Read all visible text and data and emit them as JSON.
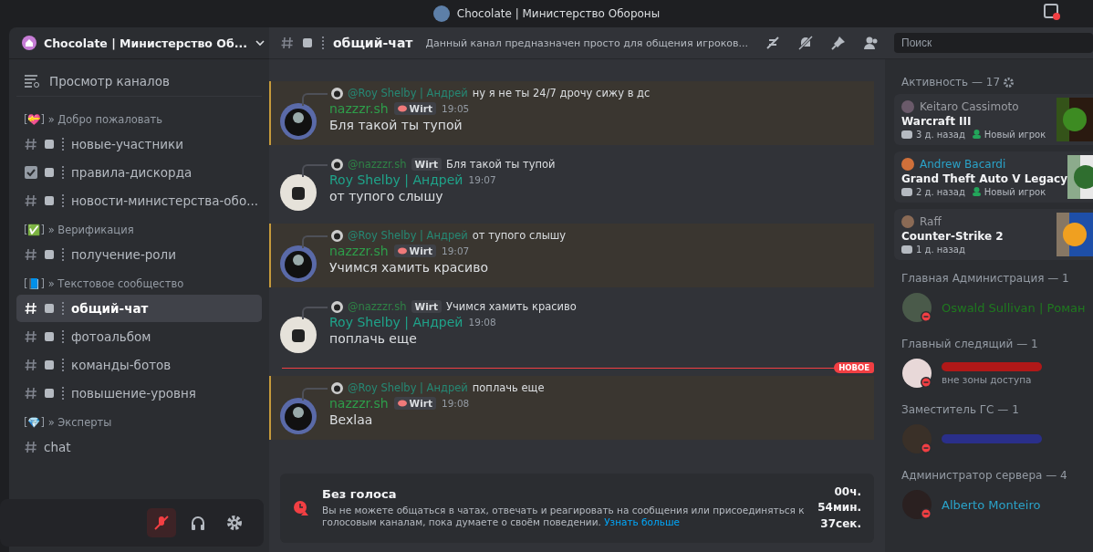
{
  "title_bar": {
    "title": "Chocolate | Министерство Обороны"
  },
  "server": {
    "name": "Chocolate | Министерство Об..."
  },
  "sidebar": {
    "browse_label": "Просмотр каналов",
    "categories": [
      {
        "name": "[💝] » Добро пожаловать",
        "channels": [
          {
            "kind": "hash",
            "label": "новые-участники",
            "selected": false
          },
          {
            "kind": "rules",
            "label": "правила-дискорда",
            "selected": false
          },
          {
            "kind": "hash",
            "label": "новости-министерства-обо...",
            "selected": false
          }
        ]
      },
      {
        "name": "[✅] » Верификация",
        "channels": [
          {
            "kind": "hash",
            "label": "получение-роли",
            "selected": false
          }
        ]
      },
      {
        "name": "[📘] » Текстовое сообщество",
        "channels": [
          {
            "kind": "hash",
            "label": "общий-чат",
            "selected": true
          },
          {
            "kind": "hash",
            "label": "фотоальбом",
            "selected": false
          },
          {
            "kind": "hash",
            "label": "команды-ботов",
            "selected": false
          },
          {
            "kind": "hash",
            "label": "повышение-уровня",
            "selected": false
          }
        ]
      },
      {
        "name": "[💎] » Эксперты",
        "channels": [
          {
            "kind": "thread",
            "label": "chat",
            "selected": false
          }
        ]
      }
    ]
  },
  "user_panel": {
    "mic_muted": true
  },
  "channel_header": {
    "name": "общий-чат",
    "topic": "Данный канал предназначен просто для общения игроков..."
  },
  "messages": [
    {
      "kind": "message",
      "mentioned": true,
      "reply_author": "@Roy Shelby | Андрей",
      "reply_badge": false,
      "reply_text": "ну я не ты 24/7 дрочу сижу в дс",
      "author": "nazzzr.sh",
      "color": "#2e9d4a",
      "badge": "Wirt",
      "time": "19:05",
      "text": "Бля такой ты тупой"
    },
    {
      "kind": "message",
      "mentioned": false,
      "reply_author": "@nazzzr.sh",
      "reply_badge": "Wirt",
      "reply_text": "Бля такой ты тупой",
      "author": "Roy Shelby | Андрей",
      "color": "#1fa38a",
      "time": "19:07",
      "text": "от тупого слышу"
    },
    {
      "kind": "message",
      "mentioned": true,
      "reply_author": "@Roy Shelby | Андрей",
      "reply_badge": false,
      "reply_text": "от тупого слышу",
      "author": "nazzzr.sh",
      "color": "#2e9d4a",
      "badge": "Wirt",
      "time": "19:07",
      "text": "Учимся хамить красиво"
    },
    {
      "kind": "message",
      "mentioned": false,
      "reply_author": "@nazzzr.sh",
      "reply_badge": "Wirt",
      "reply_text": "Учимся хамить красиво",
      "author": "Roy Shelby | Андрей",
      "color": "#1fa38a",
      "time": "19:08",
      "text": "поплачь еще"
    },
    {
      "kind": "divider",
      "label": "НОВОЕ"
    },
    {
      "kind": "message",
      "mentioned": true,
      "reply_author": "@Roy Shelby | Андрей",
      "reply_badge": false,
      "reply_text": "поплачь еще",
      "author": "nazzzr.sh",
      "color": "#2e9d4a",
      "badge": "Wirt",
      "time": "19:08",
      "text": "Bexlaa"
    }
  ],
  "notice": {
    "title": "Без голоса",
    "text": "Вы не можете общаться в чатах, отвечать и реагировать на сообщения или присоединяться к голосовым каналам, пока думаете о своём поведении.",
    "link": "Узнать больше",
    "timer": [
      "00ч.",
      "54мин.",
      "37сек."
    ]
  },
  "members": {
    "search": {
      "placeholder": "Поиск"
    },
    "activity_title": "Активность — 17",
    "activity": [
      {
        "name": "Keitaro Cassimoto",
        "color": "#9a9ca2",
        "game": "Warcraft III",
        "ago": "3 д. назад",
        "new_player": "Новый игрок"
      },
      {
        "name": "Andrew Bacardi",
        "color": "#2aa3c9",
        "game": "Grand Theft Auto V Legacy",
        "ago": "2 д. назад",
        "new_player": "Новый игрок"
      },
      {
        "name": "Raff",
        "color": "#9a9ca2",
        "game": "Counter-Strike 2",
        "ago": "1 д. назад"
      }
    ],
    "groups": [
      {
        "title": "Главная Администрация — 1",
        "members": [
          {
            "name": "Oswald Sullivan | Роман",
            "color": "#1f7a1f"
          }
        ]
      },
      {
        "title": "Главный следящий — 1",
        "members": [
          {
            "color": "#b01818",
            "status": "вне зоны доступа"
          }
        ]
      },
      {
        "title": "Заместитель ГС — 1",
        "members": [
          {
            "color": "#2a2f8a"
          }
        ]
      },
      {
        "title": "Администратор сервера — 4",
        "members": [
          {
            "name": "Alberto Monteiro",
            "color": "#2aa3c9"
          }
        ]
      }
    ]
  }
}
